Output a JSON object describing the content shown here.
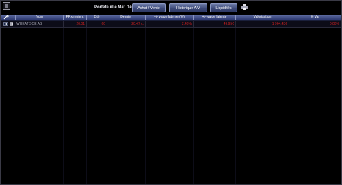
{
  "toolbar": {
    "title": "Portefeuille Mat. 1ë",
    "buttons": [
      {
        "label": "Achat / Vente"
      },
      {
        "label": "Historique A/V"
      },
      {
        "label": "Liquidités"
      }
    ],
    "print_icon": "printer-icon"
  },
  "table": {
    "headers": [
      "Nom",
      "PRx revient",
      "Qté",
      "Dernier",
      "+/- value latente (%)",
      "+/- value latente",
      "Valorisation",
      "% Var"
    ],
    "rows": [
      {
        "icons": [
          "refresh-icon",
          "document-icon"
        ],
        "cells": [
          "WHEAT SOE AB",
          "20.01",
          "60",
          "20.47 c.",
          "2.46%",
          "49.95€",
          "1 964.43€",
          "0.00%"
        ]
      }
    ]
  },
  "colors": {
    "background": "#000000",
    "header_gradient_top": "#5c6aa0",
    "header_gradient_bottom": "#2e3a72",
    "negative_value": "#d02020",
    "button_gradient": "#3d4a7a"
  }
}
